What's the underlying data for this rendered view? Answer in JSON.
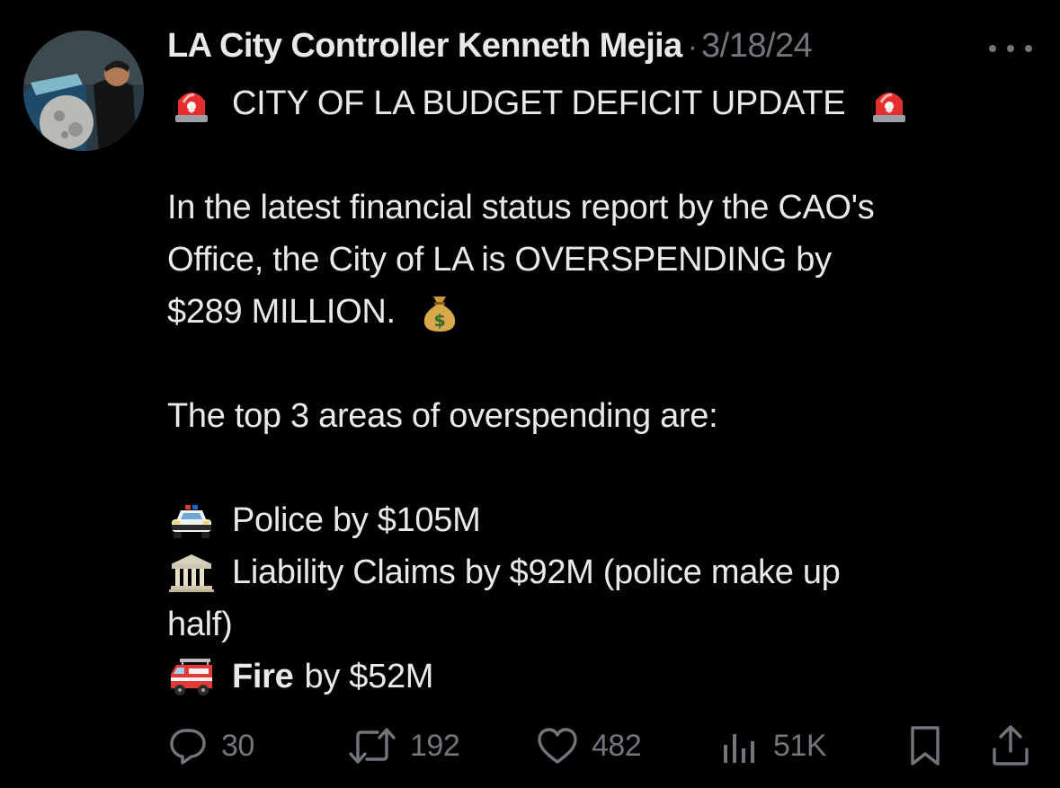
{
  "author": {
    "display_name": "LA City Controller Kenneth Mejia",
    "separator": "·",
    "date": "3/18/24"
  },
  "tweet": {
    "headline": "CITY OF LA BUDGET DEFICIT UPDATE",
    "paragraph_lines": [
      "In the latest financial status report by the CAO's",
      "Office, the City of LA is OVERSPENDING by",
      "$289 MILLION."
    ],
    "intro": "The top 3 areas of overspending are:",
    "items": [
      {
        "icon": "police-car-icon",
        "text": "Police by $105M"
      },
      {
        "icon": "classical-building-icon",
        "text": "Liability Claims by $92M (police make up",
        "continuation": "half)"
      },
      {
        "icon": "fire-engine-icon",
        "bold": "Fire",
        "text": "by $52M"
      }
    ]
  },
  "actions": {
    "replies": "30",
    "reposts": "192",
    "likes": "482",
    "views": "51K"
  },
  "colors": {
    "background": "#000000",
    "text": "#e7e9ea",
    "muted": "#71767b"
  }
}
